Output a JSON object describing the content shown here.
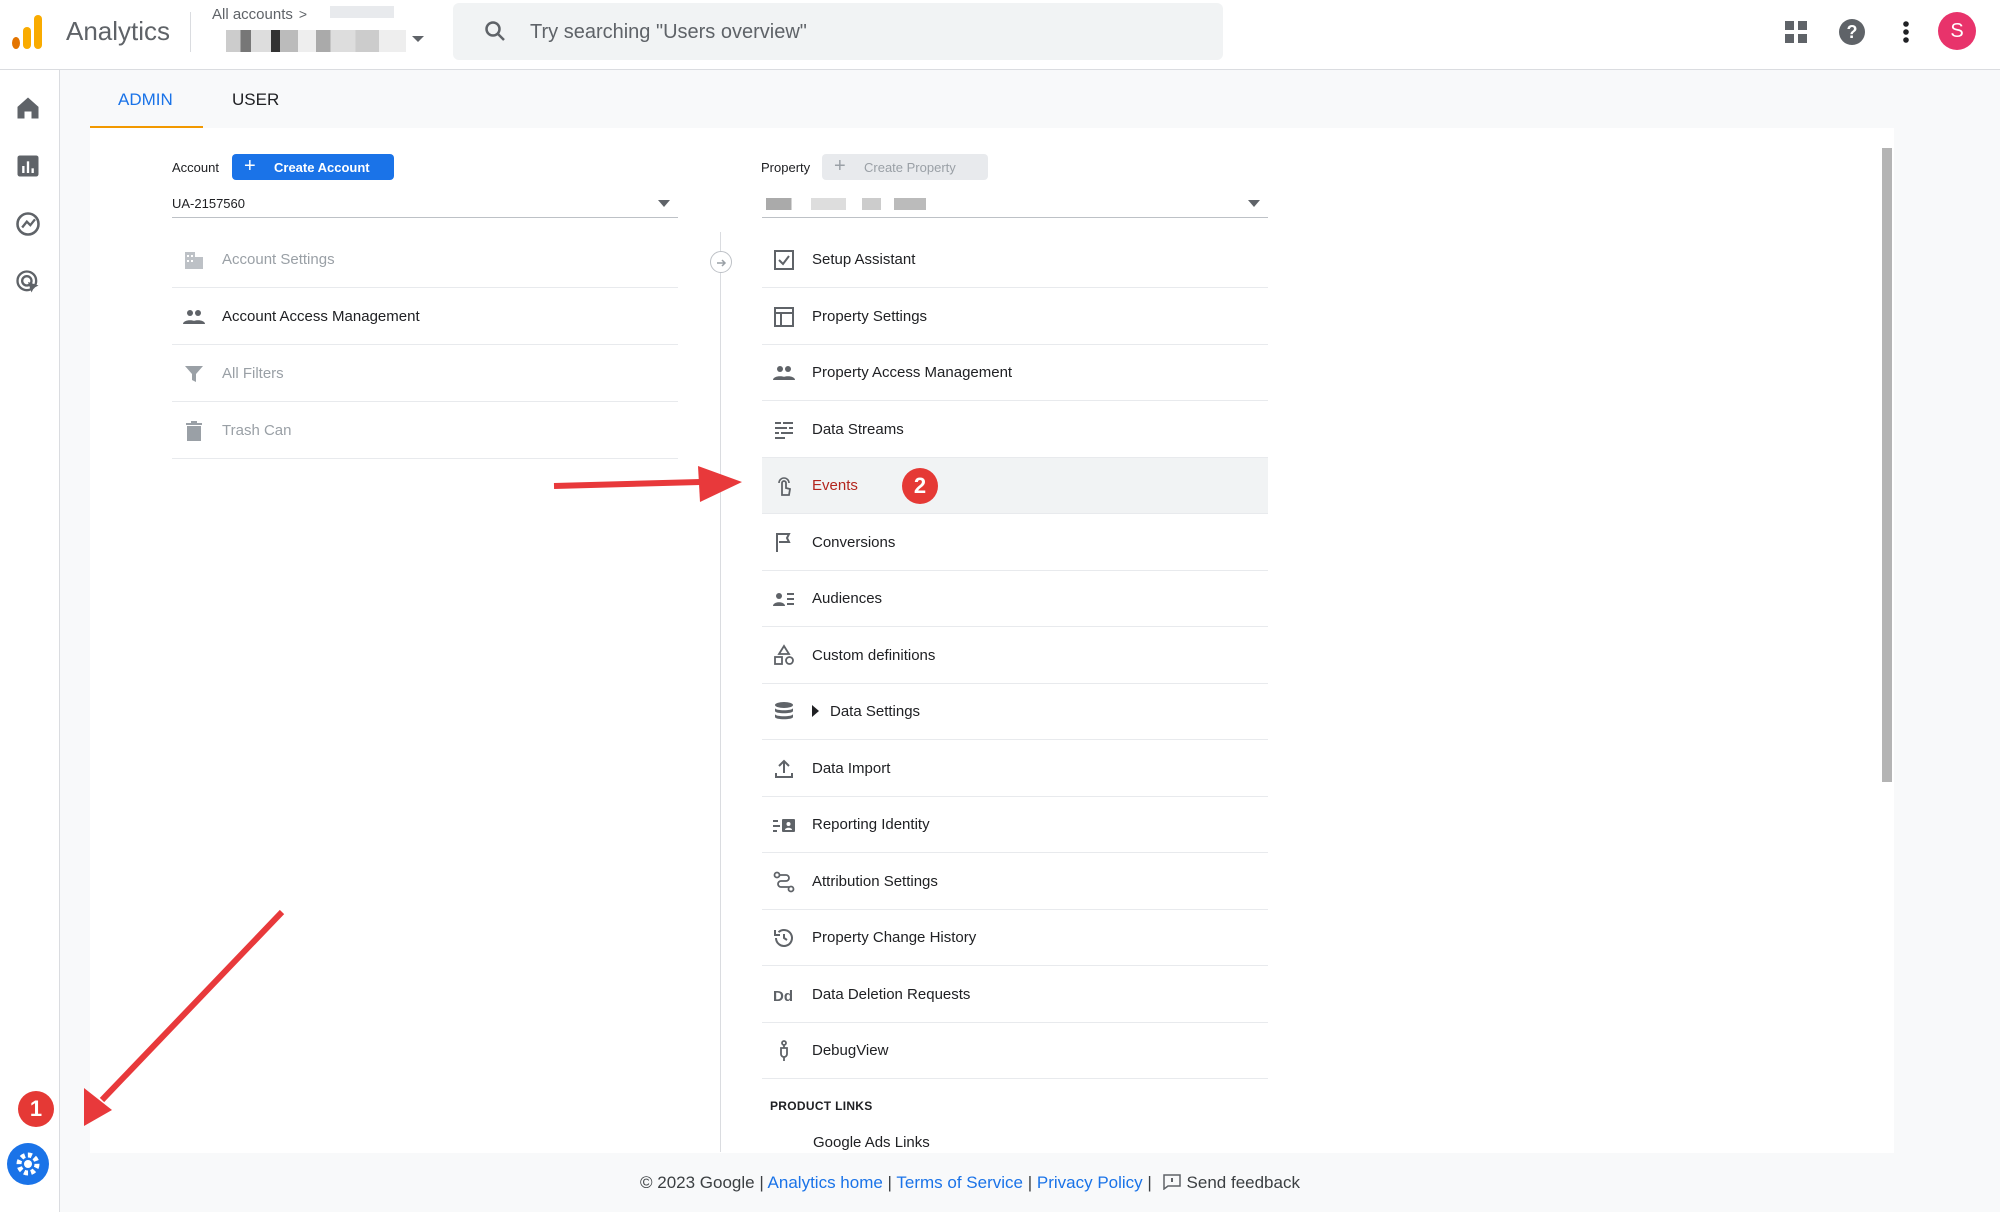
{
  "header": {
    "app_name": "Analytics",
    "account_crumb": "All accounts",
    "search_placeholder": "Try searching \"Users overview\"",
    "avatar_letter": "S"
  },
  "tabs": [
    {
      "label": "ADMIN",
      "active": true
    },
    {
      "label": "USER",
      "active": false
    }
  ],
  "account": {
    "label": "Account",
    "create_button": "Create Account",
    "selected": "UA-2157560",
    "items": [
      {
        "label": "Account Settings",
        "icon": "building-icon",
        "enabled": false
      },
      {
        "label": "Account Access Management",
        "icon": "people-icon",
        "enabled": true
      },
      {
        "label": "All Filters",
        "icon": "filter-icon",
        "enabled": false
      },
      {
        "label": "Trash Can",
        "icon": "trash-icon",
        "enabled": false
      }
    ]
  },
  "property": {
    "label": "Property",
    "create_button": "Create Property",
    "items": [
      {
        "label": "Setup Assistant",
        "icon": "checkbox-icon"
      },
      {
        "label": "Property Settings",
        "icon": "layout-icon"
      },
      {
        "label": "Property Access Management",
        "icon": "people-icon"
      },
      {
        "label": "Data Streams",
        "icon": "streams-icon"
      },
      {
        "label": "Events",
        "icon": "touch-icon",
        "active": true
      },
      {
        "label": "Conversions",
        "icon": "flag-icon"
      },
      {
        "label": "Audiences",
        "icon": "audience-icon"
      },
      {
        "label": "Custom definitions",
        "icon": "shapes-icon"
      },
      {
        "label": "Data Settings",
        "icon": "database-icon",
        "expandable": true
      },
      {
        "label": "Data Import",
        "icon": "upload-icon"
      },
      {
        "label": "Reporting Identity",
        "icon": "identity-icon"
      },
      {
        "label": "Attribution Settings",
        "icon": "route-icon"
      },
      {
        "label": "Property Change History",
        "icon": "history-icon"
      },
      {
        "label": "Data Deletion Requests",
        "icon": "dd-icon"
      },
      {
        "label": "DebugView",
        "icon": "debug-icon"
      }
    ],
    "product_links_heading": "PRODUCT LINKS",
    "product_links": [
      "Google Ads Links"
    ]
  },
  "annotations": {
    "badge_1": "1",
    "badge_2": "2"
  },
  "footer": {
    "copyright": "© 2023 Google |",
    "links": [
      "Analytics home",
      "Terms of Service",
      "Privacy Policy"
    ],
    "feedback": "Send feedback"
  },
  "colors": {
    "accent_blue": "#1a73e8",
    "active_red": "#b3261e",
    "annotation_red": "#e53935",
    "tab_underline": "#f29900",
    "avatar": "#e8336b"
  }
}
